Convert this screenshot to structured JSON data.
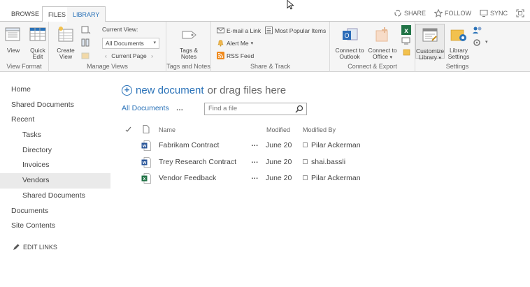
{
  "tabs": {
    "browse": "BROWSE",
    "files": "FILES",
    "library": "LIBRARY"
  },
  "top_actions": {
    "share": "SHARE",
    "follow": "FOLLOW",
    "sync": "SYNC"
  },
  "ribbon": {
    "view_format": {
      "label": "View Format",
      "view": "View",
      "quick_edit_1": "Quick",
      "quick_edit_2": "Edit"
    },
    "manage_views": {
      "label": "Manage Views",
      "create_view_1": "Create",
      "create_view_2": "View",
      "current_view_label": "Current View:",
      "current_view_value": "All Documents",
      "current_page": "Current Page"
    },
    "tags_notes": {
      "label": "Tags and Notes",
      "button_1": "Tags &",
      "button_2": "Notes"
    },
    "share_track": {
      "label": "Share & Track",
      "email_link": "E-mail a Link",
      "alert_me": "Alert Me",
      "rss_feed": "RSS Feed",
      "most_popular": "Most Popular Items"
    },
    "connect_export": {
      "label": "Connect & Export",
      "outlook_1": "Connect to",
      "outlook_2": "Outlook",
      "office_1": "Connect to",
      "office_2": "Office"
    },
    "settings": {
      "label": "Settings",
      "customize_1": "Customize",
      "customize_2": "Library",
      "library_settings_1": "Library",
      "library_settings_2": "Settings"
    }
  },
  "nav": {
    "items": [
      {
        "label": "Home",
        "level": 0,
        "selected": false
      },
      {
        "label": "Shared Documents",
        "level": 0,
        "selected": false
      },
      {
        "label": "Recent",
        "level": 0,
        "selected": false
      },
      {
        "label": "Tasks",
        "level": 1,
        "selected": false
      },
      {
        "label": "Directory",
        "level": 1,
        "selected": false
      },
      {
        "label": "Invoices",
        "level": 1,
        "selected": false
      },
      {
        "label": "Vendors",
        "level": 1,
        "selected": true
      },
      {
        "label": "Shared Documents",
        "level": 1,
        "selected": false
      },
      {
        "label": "Documents",
        "level": 0,
        "selected": false
      },
      {
        "label": "Site Contents",
        "level": 0,
        "selected": false
      }
    ],
    "edit_links": "EDIT LINKS"
  },
  "main": {
    "new_doc_link": "new document",
    "new_doc_suffix": "or drag files here",
    "current_view": "All Documents",
    "view_more": "…",
    "search_placeholder": "Find a file",
    "columns": {
      "name": "Name",
      "modified": "Modified",
      "modified_by": "Modified By"
    },
    "rows": [
      {
        "name": "Fabrikam Contract",
        "type": "word",
        "modified": "June 20",
        "modified_by": "Pilar Ackerman"
      },
      {
        "name": "Trey Research Contract",
        "type": "word",
        "modified": "June 20",
        "modified_by": "shai.bassli"
      },
      {
        "name": "Vendor Feedback",
        "type": "excel",
        "modified": "June 20",
        "modified_by": "Pilar Ackerman"
      }
    ],
    "row_menu": "…"
  },
  "colors": {
    "accent": "#2a72b8",
    "word": "#2b579a",
    "excel": "#217346"
  }
}
